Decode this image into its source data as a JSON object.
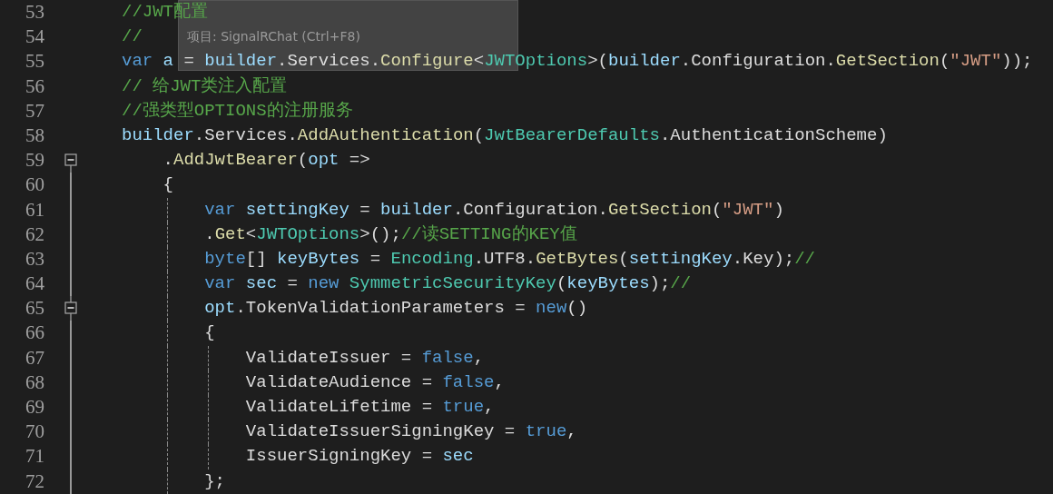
{
  "tooltip": {
    "text": "项目: SignalRChat (Ctrl+F8)"
  },
  "lines": [
    {
      "number": "53",
      "tokens": [
        {
          "kind": "comment",
          "text": "//JWT配置"
        }
      ]
    },
    {
      "number": "54",
      "tokens": [
        {
          "kind": "comment",
          "text": "//"
        }
      ]
    },
    {
      "number": "55",
      "tokens": [
        {
          "kind": "keyword",
          "text": "var"
        },
        {
          "kind": "local",
          "text": " a"
        },
        {
          "kind": "plain",
          "text": " = "
        },
        {
          "kind": "local",
          "text": "builder"
        },
        {
          "kind": "plain",
          "text": ".Services."
        },
        {
          "kind": "method",
          "text": "Configure"
        },
        {
          "kind": "plain",
          "text": "<"
        },
        {
          "kind": "type",
          "text": "JWTOptions"
        },
        {
          "kind": "plain",
          "text": ">("
        },
        {
          "kind": "local",
          "text": "builder"
        },
        {
          "kind": "plain",
          "text": ".Configuration."
        },
        {
          "kind": "method",
          "text": "GetSection"
        },
        {
          "kind": "plain",
          "text": "("
        },
        {
          "kind": "string",
          "text": "\"JWT\""
        },
        {
          "kind": "plain",
          "text": "));"
        }
      ]
    },
    {
      "number": "56",
      "tokens": [
        {
          "kind": "comment",
          "text": "// 给JWT类注入配置"
        }
      ]
    },
    {
      "number": "57",
      "tokens": [
        {
          "kind": "comment",
          "text": "//强类型OPTIONS的注册服务"
        }
      ]
    },
    {
      "number": "58",
      "tokens": [
        {
          "kind": "local",
          "text": "builder"
        },
        {
          "kind": "plain",
          "text": ".Services."
        },
        {
          "kind": "method",
          "text": "AddAuthentication"
        },
        {
          "kind": "plain",
          "text": "("
        },
        {
          "kind": "type",
          "text": "JwtBearerDefaults"
        },
        {
          "kind": "plain",
          "text": ".AuthenticationScheme)"
        }
      ]
    },
    {
      "number": "59",
      "expanded": true,
      "tokens": [
        {
          "kind": "plain",
          "text": "    ."
        },
        {
          "kind": "method",
          "text": "AddJwtBearer"
        },
        {
          "kind": "plain",
          "text": "("
        },
        {
          "kind": "local",
          "text": "opt"
        },
        {
          "kind": "plain",
          "text": " =>"
        }
      ]
    },
    {
      "number": "60",
      "tokens": [
        {
          "kind": "plain",
          "text": "    {"
        }
      ]
    },
    {
      "number": "61",
      "tokens": [
        {
          "kind": "keyword",
          "text": "        var"
        },
        {
          "kind": "local",
          "text": " settingKey"
        },
        {
          "kind": "plain",
          "text": " = "
        },
        {
          "kind": "local",
          "text": "builder"
        },
        {
          "kind": "plain",
          "text": ".Configuration."
        },
        {
          "kind": "method",
          "text": "GetSection"
        },
        {
          "kind": "plain",
          "text": "("
        },
        {
          "kind": "string",
          "text": "\"JWT\""
        },
        {
          "kind": "plain",
          "text": ")"
        }
      ]
    },
    {
      "number": "62",
      "tokens": [
        {
          "kind": "plain",
          "text": "        ."
        },
        {
          "kind": "method",
          "text": "Get"
        },
        {
          "kind": "plain",
          "text": "<"
        },
        {
          "kind": "type",
          "text": "JWTOptions"
        },
        {
          "kind": "plain",
          "text": ">();"
        },
        {
          "kind": "comment",
          "text": "//读SETTING的KEY值"
        }
      ]
    },
    {
      "number": "63",
      "tokens": [
        {
          "kind": "keyword",
          "text": "        byte"
        },
        {
          "kind": "plain",
          "text": "[] "
        },
        {
          "kind": "local",
          "text": "keyBytes"
        },
        {
          "kind": "plain",
          "text": " = "
        },
        {
          "kind": "type",
          "text": "Encoding"
        },
        {
          "kind": "plain",
          "text": ".UTF8."
        },
        {
          "kind": "method",
          "text": "GetBytes"
        },
        {
          "kind": "plain",
          "text": "("
        },
        {
          "kind": "local",
          "text": "settingKey"
        },
        {
          "kind": "plain",
          "text": ".Key);"
        },
        {
          "kind": "comment",
          "text": "//"
        }
      ]
    },
    {
      "number": "64",
      "tokens": [
        {
          "kind": "keyword",
          "text": "        var"
        },
        {
          "kind": "local",
          "text": " sec"
        },
        {
          "kind": "plain",
          "text": " = "
        },
        {
          "kind": "keyword",
          "text": "new"
        },
        {
          "kind": "type",
          "text": " SymmetricSecurityKey"
        },
        {
          "kind": "plain",
          "text": "("
        },
        {
          "kind": "local",
          "text": "keyBytes"
        },
        {
          "kind": "plain",
          "text": ");"
        },
        {
          "kind": "comment",
          "text": "//"
        }
      ]
    },
    {
      "number": "65",
      "expanded": true,
      "tokens": [
        {
          "kind": "local",
          "text": "        opt"
        },
        {
          "kind": "plain",
          "text": ".TokenValidationParameters = "
        },
        {
          "kind": "keyword",
          "text": "new"
        },
        {
          "kind": "plain",
          "text": "()"
        }
      ]
    },
    {
      "number": "66",
      "tokens": [
        {
          "kind": "plain",
          "text": "        {"
        }
      ]
    },
    {
      "number": "67",
      "tokens": [
        {
          "kind": "plain",
          "text": "            ValidateIssuer = "
        },
        {
          "kind": "keyword",
          "text": "false"
        },
        {
          "kind": "plain",
          "text": ","
        }
      ]
    },
    {
      "number": "68",
      "tokens": [
        {
          "kind": "plain",
          "text": "            ValidateAudience = "
        },
        {
          "kind": "keyword",
          "text": "false"
        },
        {
          "kind": "plain",
          "text": ","
        }
      ]
    },
    {
      "number": "69",
      "tokens": [
        {
          "kind": "plain",
          "text": "            ValidateLifetime = "
        },
        {
          "kind": "keyword",
          "text": "true"
        },
        {
          "kind": "plain",
          "text": ","
        }
      ]
    },
    {
      "number": "70",
      "tokens": [
        {
          "kind": "plain",
          "text": "            ValidateIssuerSigningKey = "
        },
        {
          "kind": "keyword",
          "text": "true"
        },
        {
          "kind": "plain",
          "text": ","
        }
      ]
    },
    {
      "number": "71",
      "tokens": [
        {
          "kind": "plain",
          "text": "            IssuerSigningKey = "
        },
        {
          "kind": "local",
          "text": "sec"
        }
      ]
    },
    {
      "number": "72",
      "tokens": [
        {
          "kind": "plain",
          "text": "        };"
        }
      ]
    }
  ]
}
